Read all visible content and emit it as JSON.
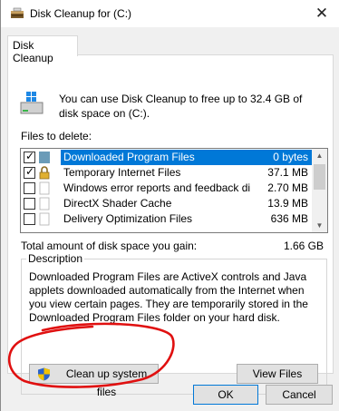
{
  "window": {
    "title": "Disk Cleanup for  (C:)",
    "close_glyph": "✕"
  },
  "tabs": [
    {
      "label": "Disk Cleanup"
    }
  ],
  "intro_text": "You can use Disk Cleanup to free up to 32.4 GB of disk space on  (C:).",
  "files_label": "Files to delete:",
  "files": [
    {
      "name": "Downloaded Program Files",
      "size": "0 bytes",
      "checked": true,
      "selected": true,
      "icon": "folder-icon"
    },
    {
      "name": "Temporary Internet Files",
      "size": "37.1 MB",
      "checked": true,
      "selected": false,
      "icon": "lock-icon"
    },
    {
      "name": "Windows error reports and feedback di...",
      "size": "2.70 MB",
      "checked": false,
      "selected": false,
      "icon": "blank-icon"
    },
    {
      "name": "DirectX Shader Cache",
      "size": "13.9 MB",
      "checked": false,
      "selected": false,
      "icon": "blank-icon"
    },
    {
      "name": "Delivery Optimization Files",
      "size": "636 MB",
      "checked": false,
      "selected": false,
      "icon": "blank-icon"
    }
  ],
  "total_label": "Total amount of disk space you gain:",
  "total_value": "1.66 GB",
  "description": {
    "legend": "Description",
    "text": "Downloaded Program Files are ActiveX controls and Java applets downloaded automatically from the Internet when you view certain pages. They are temporarily stored in the Downloaded Program Files folder on your hard disk."
  },
  "buttons": {
    "cleanup_system": "Clean up system files",
    "view_files": "View Files",
    "ok": "OK",
    "cancel": "Cancel"
  },
  "colors": {
    "selection": "#0078d7",
    "annotation": "#e01010"
  }
}
